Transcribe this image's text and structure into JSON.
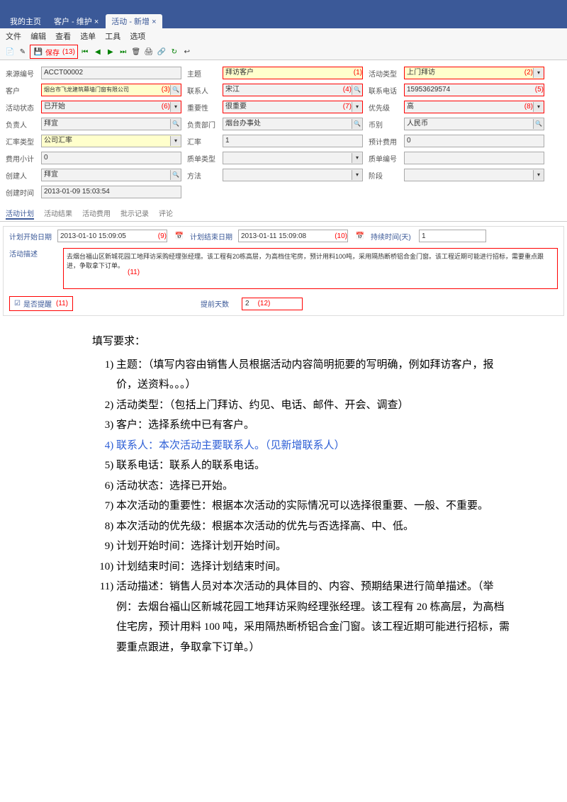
{
  "header": {
    "tabs": [
      "我的主页",
      "客户 - 维护",
      "活动 - 新增"
    ]
  },
  "menubar": [
    "文件",
    "编辑",
    "查看",
    "选单",
    "工具",
    "选项"
  ],
  "toolbar": {
    "highlightMarker": "(13)",
    "save": "保存"
  },
  "form": {
    "r1": {
      "c1": {
        "label": "来源编号",
        "value": "ACCT00002"
      },
      "c2": {
        "label": "主题",
        "value": "拜访客户",
        "marker": "(1)"
      },
      "c3": {
        "label": "活动类型",
        "value": "上门拜访",
        "marker": "(2)"
      }
    },
    "r2": {
      "c1": {
        "label": "客户",
        "value": "烟台市飞龙建筑幕墙门窗有限公司",
        "marker": "(3)"
      },
      "c2": {
        "label": "联系人",
        "value": "宋江",
        "marker": "(4)"
      },
      "c3": {
        "label": "联系电话",
        "value": "15953629574",
        "marker": "(5)"
      }
    },
    "r3": {
      "c1": {
        "label": "活动状态",
        "value": "已开始",
        "marker": "(6)"
      },
      "c2": {
        "label": "重要性",
        "value": "很重要",
        "marker": "(7)"
      },
      "c3": {
        "label": "优先级",
        "value": "高",
        "marker": "(8)"
      }
    },
    "r4": {
      "c1": {
        "label": "负责人",
        "value": "拜宜"
      },
      "c2": {
        "label": "负责部门",
        "value": "烟台办事处"
      },
      "c3": {
        "label": "币别",
        "value": "人民币"
      }
    },
    "r5": {
      "c1": {
        "label": "汇率类型",
        "value": "公司汇率"
      },
      "c2": {
        "label": "汇率",
        "value": "1"
      },
      "c3": {
        "label": "预计费用",
        "value": "0"
      }
    },
    "r6": {
      "c1": {
        "label": "费用小计",
        "value": "0"
      },
      "c2": {
        "label": "质单类型",
        "value": ""
      },
      "c3": {
        "label": "质单编号",
        "value": ""
      }
    },
    "r7": {
      "c1": {
        "label": "创建人",
        "value": "拜宜"
      },
      "c2": {
        "label": "方法",
        "value": ""
      },
      "c3": {
        "label": "阶段",
        "value": ""
      }
    },
    "r8": {
      "c1": {
        "label": "创建时间",
        "value": "2013-01-09 15:03:54"
      }
    }
  },
  "subtabs": [
    "活动计划",
    "活动结果",
    "活动费用",
    "批示记录",
    "评论"
  ],
  "plan": {
    "startLabel": "计划开始日期",
    "startVal": "2013-01-10 15:09:05",
    "startMarker": "(9)",
    "endLabel": "计划结束日期",
    "endVal": "2013-01-11 15:09:08",
    "endMarker": "(10)",
    "durLabel": "持续时间(天)",
    "durVal": "1",
    "descLabel": "活动描述",
    "descVal": "去烟台福山区新城花园工地拜访采购经理张经理。该工程有20栋高层，为高档住宅房，预计用料100吨，采用隔热断桥铝合金门窗。该工程近期可能进行招标，需要重点跟进，争取拿下订单。",
    "descMarker": "(11)",
    "remindLabel": "是否提醒",
    "remindMarker": "(11)",
    "advanceLabel": "提前天数",
    "advanceVal": "2",
    "advanceMarker": "(12)"
  },
  "instructions": {
    "title": "填写要求：",
    "items": [
      "主题：（填写内容由销售人员根据活动内容简明扼要的写明确，例如拜访客户，报价，送资料。。。）",
      "活动类型：（包括上门拜访、约见、电话、邮件、开会、调查）",
      "客户：选择系统中已有客户。",
      "联系人：本次活动主要联系人。（见新增联系人）",
      "联系电话：联系人的联系电话。",
      "活动状态：选择已开始。",
      "本次活动的重要性：根据本次活动的实际情况可以选择很重要、一般、不重要。",
      "本次活动的优先级：根据本次活动的优先与否选择高、中、低。",
      "计划开始时间：选择计划开始时间。",
      "计划结束时间：选择计划结束时间。",
      "活动描述：销售人员对本次活动的具体目的、内容、预期结果进行简单描述。（举例：去烟台福山区新城花园工地拜访采购经理张经理。该工程有 20 栋高层，为高档住宅房，预计用料 100 吨，采用隔热断桥铝合金门窗。该工程近期可能进行招标，需要重点跟进，争取拿下订单。）"
    ]
  }
}
